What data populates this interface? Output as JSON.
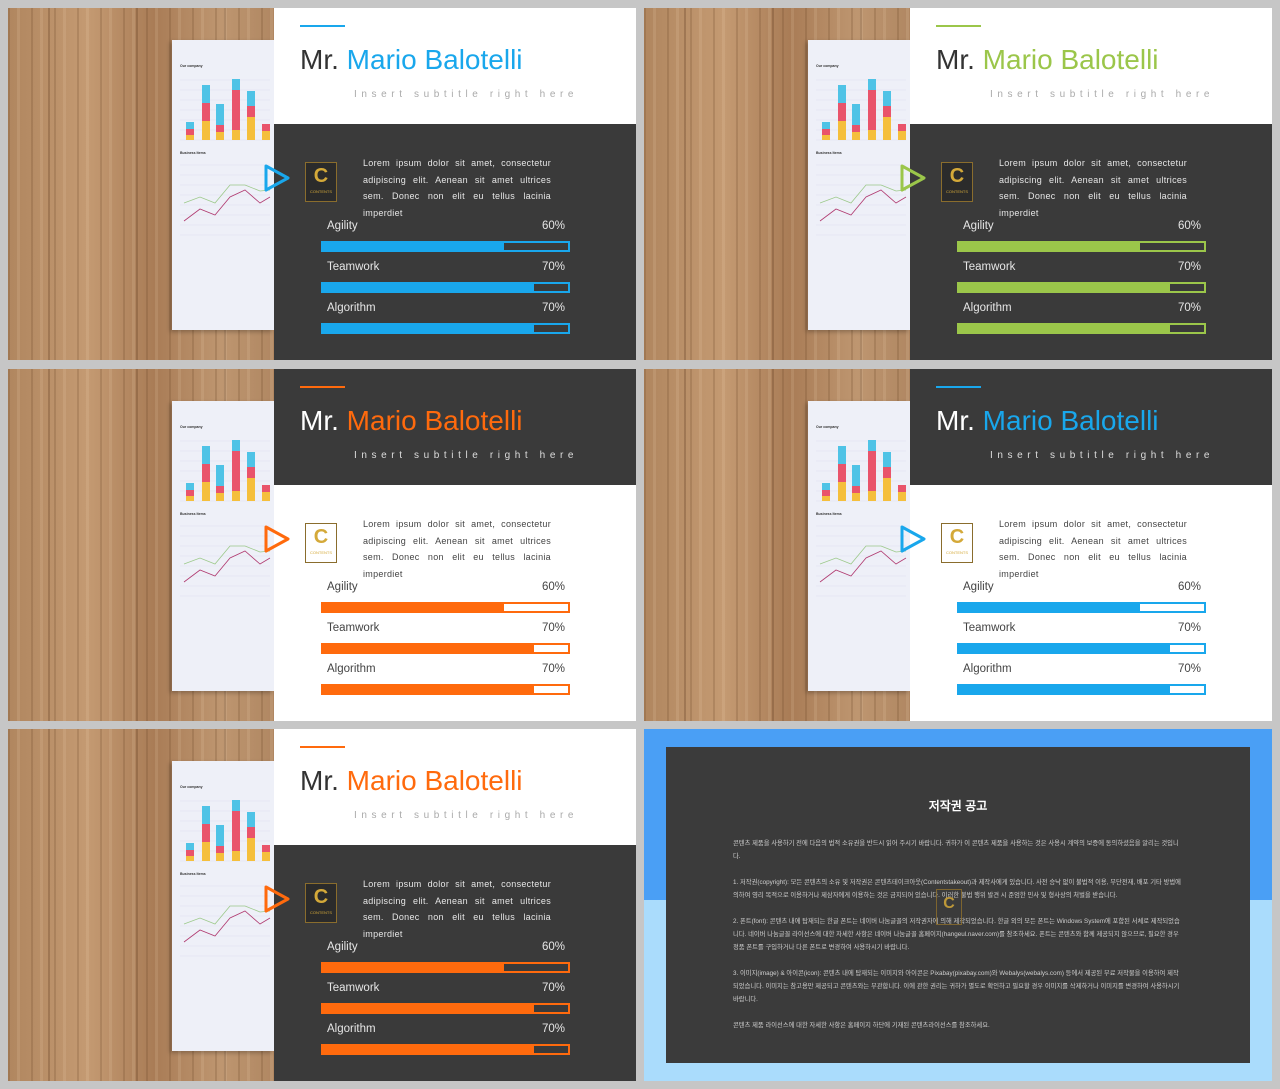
{
  "colors": {
    "blue": "#19a7ec",
    "green": "#9bc64a",
    "orange": "#ff6a0d",
    "dark": "#3a3a3a",
    "white": "#ffffff"
  },
  "slide_common": {
    "title_prefix": "Mr. ",
    "title_name": "Mario Balotelli",
    "subtitle": "Insert subtitle right here",
    "body": "Lorem ipsum dolor sit amet, consectetur adipiscing elit. Aenean sit amet ultrices sem. Donec non elit eu tellus lacinia imperdiet",
    "logo_letter": "C",
    "logo_text": "CONTENTS",
    "paper_chart_title": "Our company",
    "paper_line_title": "Business Items",
    "skills": [
      {
        "label": "Agility",
        "value": 60,
        "value_text": "60%"
      },
      {
        "label": "Teamwork",
        "value": 70,
        "value_text": "70%"
      },
      {
        "label": "Algorithm",
        "value": 70,
        "value_text": "70%"
      }
    ]
  },
  "slides": [
    {
      "accent": "blue",
      "header_theme": "light",
      "lower_theme": "dark"
    },
    {
      "accent": "green",
      "header_theme": "light",
      "lower_theme": "dark"
    },
    {
      "accent": "orange",
      "header_theme": "dark",
      "lower_theme": "light"
    },
    {
      "accent": "blue",
      "header_theme": "dark",
      "lower_theme": "light"
    },
    {
      "accent": "orange",
      "header_theme": "light",
      "lower_theme": "dark"
    }
  ],
  "copyright": {
    "title": "저작권 공고",
    "top_color": "#4a9ff5",
    "bottom_color": "#aadcfc",
    "logo_letter": "C",
    "paragraphs": [
      "콘텐츠 제품을 사용하기 전에 다음의 법적 소유권을 반드시 읽어 주시기 바랍니다. 귀하가 이 콘텐츠 제품을 사용하는 것은 사용시 계약의 보증에 동의하셨음을 알리는 것입니다.",
      "1. 저작권(copyright): 모든 콘텐츠의 소유 및 저작권은 콘텐츠테이크아웃(Contentstakeout)과 제작사에게 있습니다. 사전 승낙 없이 불법적 이용, 무단전재, 배포 기타 방법에 의하여 영리 목적으로 이용하거나 제삼자에게 이용하는 것은 금지되어 있습니다. 이러한 불법 행위 발견 시 준엄한 민사 및 형사상의 처벌을 받습니다.",
      "2. 폰트(font): 콘텐츠 내에 탑재되는 한글 폰트는 네이버 나눔글꼴의 저작권자에 의해 제작되었습니다. 한글 외의 모든 폰트는 Windows System에 포함된 서체로 제작되었습니다. 네이버 나눔글꼴 라이선스에 대한 자세한 사항은 네이버 나눔글꼴 홈페이지(hangeul.naver.com)를 참조하세요. 폰트는 콘텐츠와 함께 제공되지 않으므로, 필요한 경우 정품 폰트를 구입하거나 다른 폰트로 변경하여 사용하시기 바랍니다.",
      "3. 이미지(image) & 아이콘(icon): 콘텐츠 내에 탑재되는 이미지와 아이콘은 Pixabay(pixabay.com)와 Webalys(webalys.com) 등에서 제공된 무료 저작물을 이용하여 제작되었습니다. 이미지는 참고용만 제공되고 콘텐츠와는 무관합니다. 이에 관한 권리는 귀하가 별도로 확인하고 필요할 경우 이미지를 삭제하거나 이미지를 변경하여 사용하시기 바랍니다.",
      "콘텐츠 제품 라이선스에 대한 자세한 사항은 홈페이지 하단에 기재된 콘텐츠라이선스를 참조하세요."
    ]
  }
}
